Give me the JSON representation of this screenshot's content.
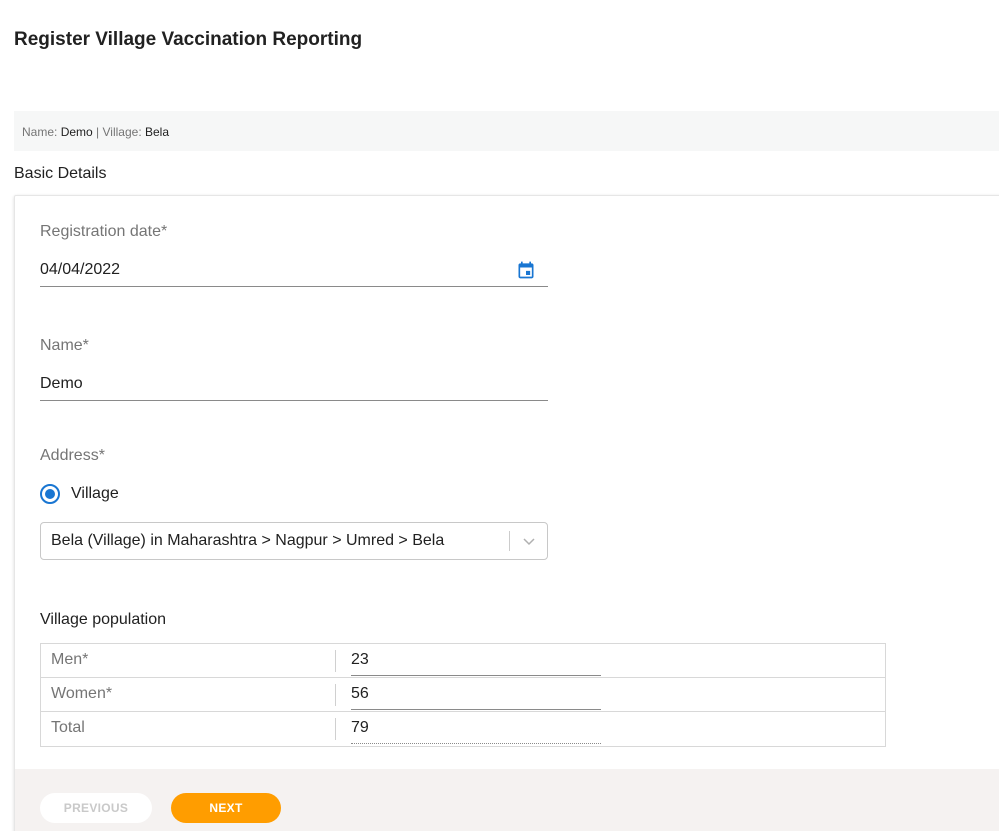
{
  "page": {
    "title": "Register Village Vaccination Reporting"
  },
  "summary": {
    "name_label": "Name:",
    "name_value": "Demo",
    "separator": "|",
    "village_label": "Village:",
    "village_value": "Bela"
  },
  "section": {
    "title": "Basic Details"
  },
  "form": {
    "registration_date": {
      "label": "Registration date*",
      "value": "04/04/2022",
      "icon": "calendar-icon"
    },
    "name": {
      "label": "Name*",
      "value": "Demo"
    },
    "address": {
      "label": "Address*",
      "radio_option": "Village",
      "radio_selected": true,
      "select_value": "Bela (Village) in Maharashtra > Nagpur > Umred > Bela",
      "select_icon": "chevron-down-icon"
    },
    "population": {
      "title": "Village population",
      "rows": [
        {
          "label": "Men*",
          "value": "23"
        },
        {
          "label": "Women*",
          "value": "56"
        },
        {
          "label": "Total",
          "value": "79"
        }
      ]
    }
  },
  "footer": {
    "previous_label": "PREVIOUS",
    "next_label": "NEXT"
  },
  "colors": {
    "accent": "#1976d2",
    "next_button": "#ff9d00",
    "footer_bg": "#f5f2f1",
    "summary_bg": "#f6f7f7"
  }
}
